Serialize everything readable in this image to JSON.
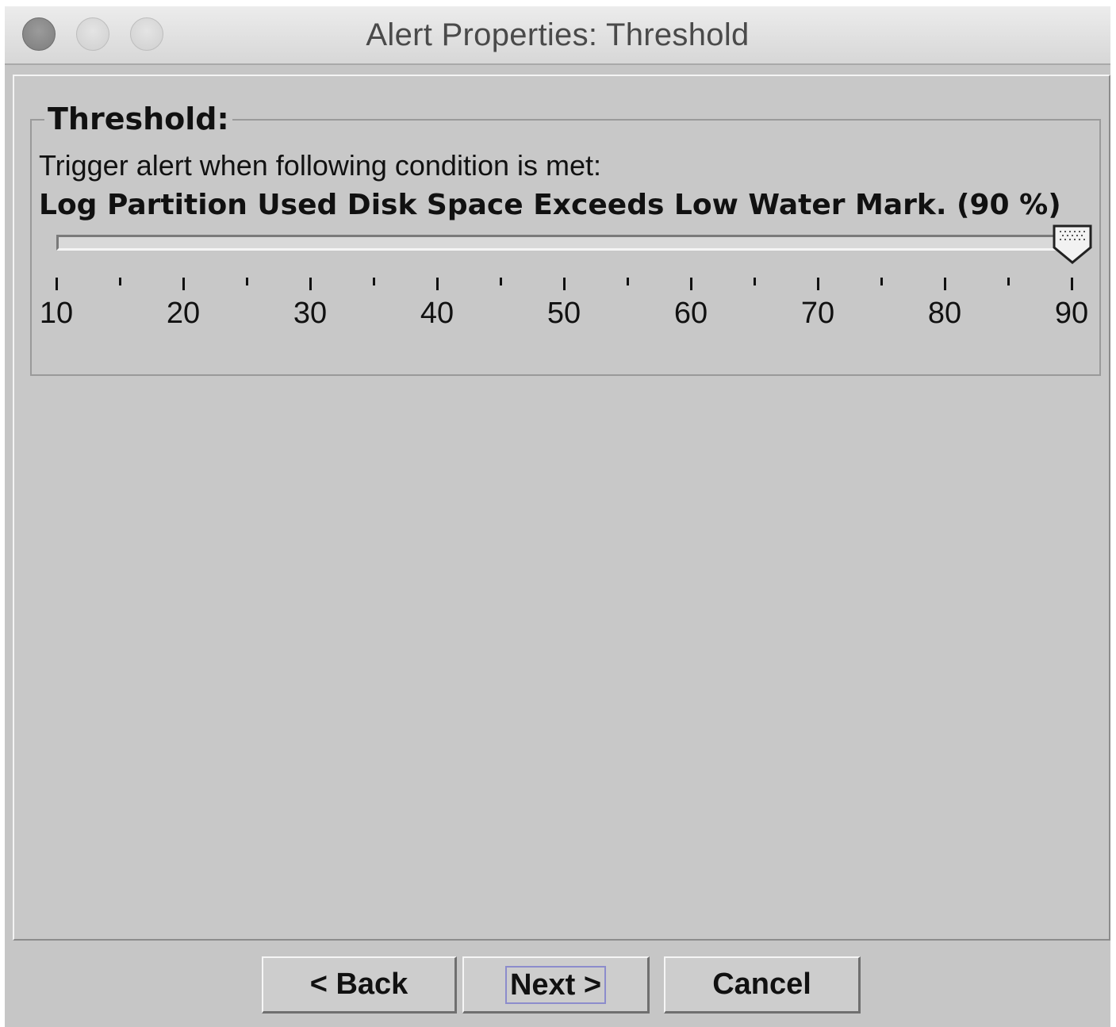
{
  "window": {
    "title": "Alert Properties: Threshold"
  },
  "threshold": {
    "legend": "Threshold:",
    "description": "Trigger alert when following condition is met:",
    "condition": "Log Partition Used Disk Space Exceeds Low Water Mark. (90 %)"
  },
  "slider": {
    "min": 10,
    "max": 90,
    "value": 90,
    "major_tick_labels": [
      "10",
      "20",
      "30",
      "40",
      "50",
      "60",
      "70",
      "80",
      "90"
    ]
  },
  "buttons": {
    "back": "< Back",
    "next": "Next >",
    "cancel": "Cancel"
  }
}
